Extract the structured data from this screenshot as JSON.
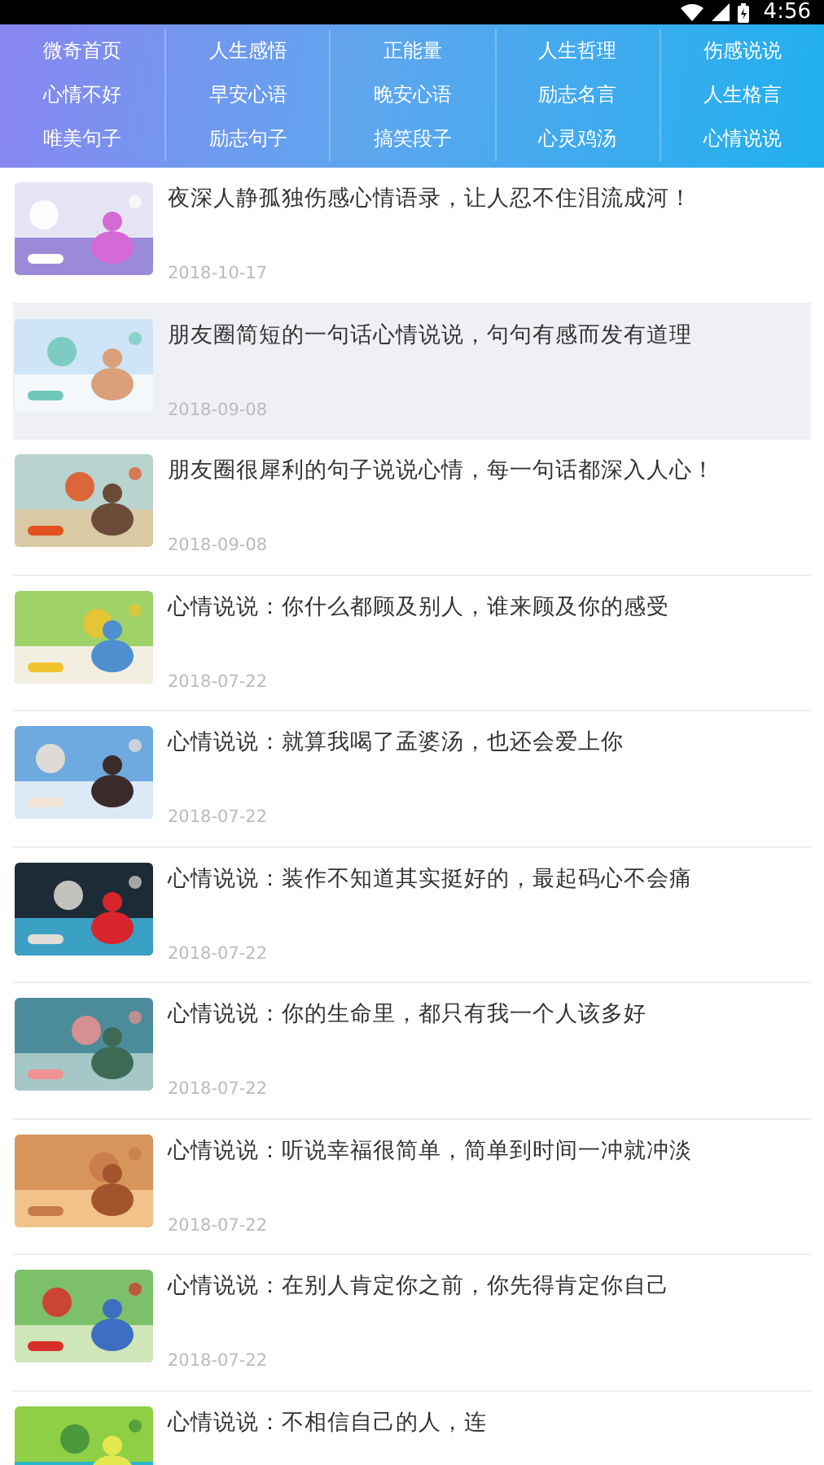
{
  "status_bar": {
    "time": "4:56"
  },
  "nav": [
    {
      "label": "微奇首页"
    },
    {
      "label": "人生感悟"
    },
    {
      "label": "正能量"
    },
    {
      "label": "人生哲理"
    },
    {
      "label": "伤感说说"
    },
    {
      "label": "心情不好"
    },
    {
      "label": "早安心语"
    },
    {
      "label": "晚安心语"
    },
    {
      "label": "励志名言"
    },
    {
      "label": "人生格言"
    },
    {
      "label": "唯美句子"
    },
    {
      "label": "励志句子"
    },
    {
      "label": "搞笑段子"
    },
    {
      "label": "心灵鸡汤"
    },
    {
      "label": "心情说说"
    }
  ],
  "articles": [
    {
      "title": "夜深人静孤独伤感心情语录，让人忍不住泪流成河！",
      "date": "2018-10-17",
      "selected": false
    },
    {
      "title": "朋友圈简短的一句话心情说说，句句有感而发有道理",
      "date": "2018-09-08",
      "selected": true
    },
    {
      "title": "朋友圈很犀利的句子说说心情，每一句话都深入人心！",
      "date": "2018-09-08",
      "selected": false
    },
    {
      "title": "心情说说：你什么都顾及别人，谁来顾及你的感受",
      "date": "2018-07-22",
      "selected": false
    },
    {
      "title": "心情说说：就算我喝了孟婆汤，也还会爱上你",
      "date": "2018-07-22",
      "selected": false
    },
    {
      "title": "心情说说：装作不知道其实挺好的，最起码心不会痛",
      "date": "2018-07-22",
      "selected": false
    },
    {
      "title": "心情说说：你的生命里，都只有我一个人该多好",
      "date": "2018-07-22",
      "selected": false
    },
    {
      "title": "心情说说：听说幸福很简单，简单到时间一冲就冲淡",
      "date": "2018-07-22",
      "selected": false
    },
    {
      "title": "心情说说：在别人肯定你之前，你先得肯定你自己",
      "date": "2018-07-22",
      "selected": false
    },
    {
      "title": "心情说说：不相信自己的人，连",
      "selected": false
    }
  ]
}
